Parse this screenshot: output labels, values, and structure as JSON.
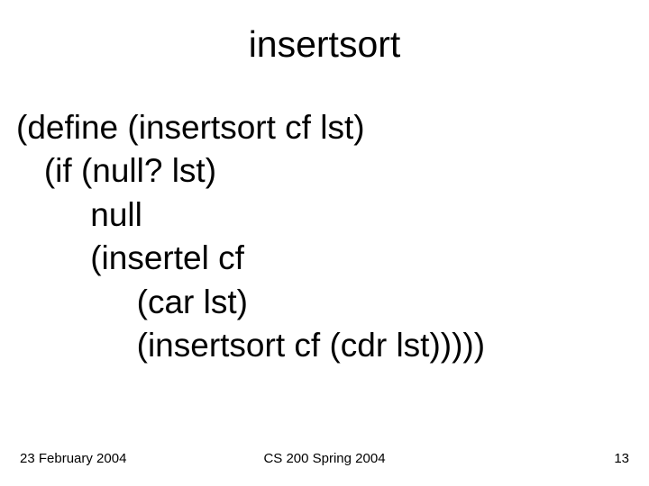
{
  "title": "insertsort",
  "code": "(define (insertsort cf lst)\n   (if (null? lst)\n        null\n        (insertel cf\n             (car lst)\n             (insertsort cf (cdr lst)))))",
  "footer": {
    "left": "23 February 2004",
    "center": "CS 200 Spring 2004",
    "right": "13"
  }
}
